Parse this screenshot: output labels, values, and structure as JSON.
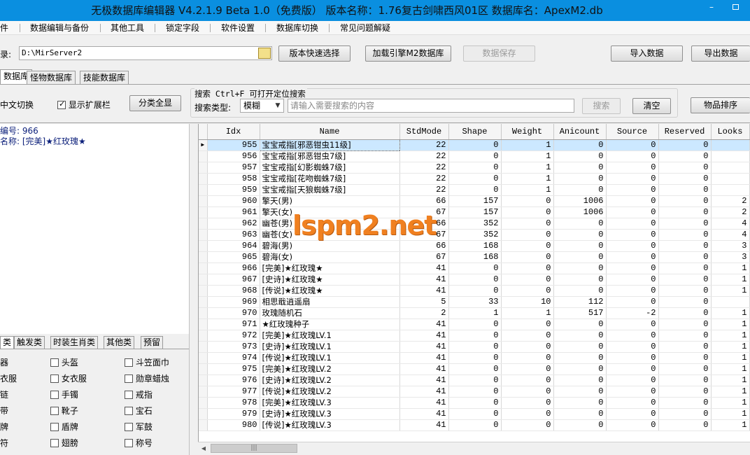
{
  "window": {
    "title": "无极数据库编辑器 V4.2.1.9    Beta 1.0（免费版）    版本名称：1.76复古剑啸西风01区    数据库名：ApexM2.db",
    "minimize": "–"
  },
  "menu": [
    "件",
    "数据编辑与备份",
    "其他工具",
    "锁定字段",
    "软件设置",
    "数据库切换",
    "常见问题解疑"
  ],
  "toolbar": {
    "dir_label": "录:",
    "dir_value": "D:\\MirServer2",
    "version_btn": "版本快速选择",
    "load_btn": "加载引擎M2数据库",
    "save_btn": "数据保存",
    "import_btn": "导入数据",
    "export_btn": "导出数据"
  },
  "tabs": [
    "数据库",
    "怪物数据库",
    "技能数据库"
  ],
  "options": {
    "lang_switch": "中文切换",
    "show_ext": "显示扩展栏",
    "show_all": "分类全显"
  },
  "search": {
    "title": "搜索   Ctrl+F 可打开定位搜索",
    "type_label": "搜索类型:",
    "type_value": "模糊",
    "placeholder": "请输入需要搜索的内容",
    "search_btn": "搜索",
    "clear_btn": "清空",
    "sort_btn": "物品排序"
  },
  "detail": {
    "id_line": "编号: 966",
    "name_line": "名称: [完美]★红玫瑰★"
  },
  "category_tabs": [
    "类",
    "触发类",
    "时装生肖类",
    "其他类",
    "预留"
  ],
  "categories": [
    [
      "器",
      "头盔",
      "斗笠面巾"
    ],
    [
      "衣服",
      "女衣服",
      "勋章蜡烛"
    ],
    [
      "链",
      "手镯",
      "戒指"
    ],
    [
      "带",
      "靴子",
      "宝石"
    ],
    [
      "牌",
      "盾牌",
      "军鼓"
    ],
    [
      "符",
      "翅膀",
      "称号"
    ]
  ],
  "grid": {
    "columns": [
      "Idx",
      "Name",
      "StdMode",
      "Shape",
      "Weight",
      "Anicount",
      "Source",
      "Reserved",
      "Looks"
    ],
    "rows": [
      [
        "955",
        "宝宝戒指[邪恶钳虫11级]",
        "22",
        "0",
        "1",
        "0",
        "0",
        "0",
        ""
      ],
      [
        "956",
        "宝宝戒指[邪恶钳虫7级]",
        "22",
        "0",
        "1",
        "0",
        "0",
        "0",
        ""
      ],
      [
        "957",
        "宝宝戒指[幻影蜘蛛7级]",
        "22",
        "0",
        "1",
        "0",
        "0",
        "0",
        ""
      ],
      [
        "958",
        "宝宝戒指[花吻蜘蛛7级]",
        "22",
        "0",
        "1",
        "0",
        "0",
        "0",
        ""
      ],
      [
        "959",
        "宝宝戒指[天狼蜘蛛7级]",
        "22",
        "0",
        "1",
        "0",
        "0",
        "0",
        ""
      ],
      [
        "960",
        "擎天(男)",
        "66",
        "157",
        "0",
        "1006",
        "0",
        "0",
        "2"
      ],
      [
        "961",
        "擎天(女)",
        "67",
        "157",
        "0",
        "1006",
        "0",
        "0",
        "2"
      ],
      [
        "962",
        "幽苍(男)",
        "66",
        "352",
        "0",
        "0",
        "0",
        "0",
        "4"
      ],
      [
        "963",
        "幽苍(女)",
        "67",
        "352",
        "0",
        "0",
        "0",
        "0",
        "4"
      ],
      [
        "964",
        "碧海(男)",
        "66",
        "168",
        "0",
        "0",
        "0",
        "0",
        "3"
      ],
      [
        "965",
        "碧海(女)",
        "67",
        "168",
        "0",
        "0",
        "0",
        "0",
        "3"
      ],
      [
        "966",
        "[完美]★红玫瑰★",
        "41",
        "0",
        "0",
        "0",
        "0",
        "0",
        "1"
      ],
      [
        "967",
        "[史诗]★红玫瑰★",
        "41",
        "0",
        "0",
        "0",
        "0",
        "0",
        "1"
      ],
      [
        "968",
        "[传说]★红玫瑰★",
        "41",
        "0",
        "0",
        "0",
        "0",
        "0",
        "1"
      ],
      [
        "969",
        "相思戢逍遥扇",
        "5",
        "33",
        "10",
        "112",
        "0",
        "0",
        ""
      ],
      [
        "970",
        "玫瑰随机石",
        "2",
        "1",
        "1",
        "517",
        "-2",
        "0",
        "1"
      ],
      [
        "971",
        "★红玫瑰种子",
        "41",
        "0",
        "0",
        "0",
        "0",
        "0",
        "1"
      ],
      [
        "972",
        "[完美]★红玫瑰LV.1",
        "41",
        "0",
        "0",
        "0",
        "0",
        "0",
        "1"
      ],
      [
        "973",
        "[史诗]★红玫瑰LV.1",
        "41",
        "0",
        "0",
        "0",
        "0",
        "0",
        "1"
      ],
      [
        "974",
        "[传说]★红玫瑰LV.1",
        "41",
        "0",
        "0",
        "0",
        "0",
        "0",
        "1"
      ],
      [
        "975",
        "[完美]★红玫瑰LV.2",
        "41",
        "0",
        "0",
        "0",
        "0",
        "0",
        "1"
      ],
      [
        "976",
        "[史诗]★红玫瑰LV.2",
        "41",
        "0",
        "0",
        "0",
        "0",
        "0",
        "1"
      ],
      [
        "977",
        "[传说]★红玫瑰LV.2",
        "41",
        "0",
        "0",
        "0",
        "0",
        "0",
        "1"
      ],
      [
        "978",
        "[完美]★红玫瑰LV.3",
        "41",
        "0",
        "0",
        "0",
        "0",
        "0",
        "1"
      ],
      [
        "979",
        "[史诗]★红玫瑰LV.3",
        "41",
        "0",
        "0",
        "0",
        "0",
        "0",
        "1"
      ],
      [
        "980",
        "[传说]★红玫瑰LV.3",
        "41",
        "0",
        "0",
        "0",
        "0",
        "0",
        "1"
      ]
    ]
  },
  "watermark": "lspm2.net",
  "colors": {
    "titlebar": "#0a8fe0",
    "selected_row": "#cce8ff",
    "watermark": "#f08020"
  }
}
